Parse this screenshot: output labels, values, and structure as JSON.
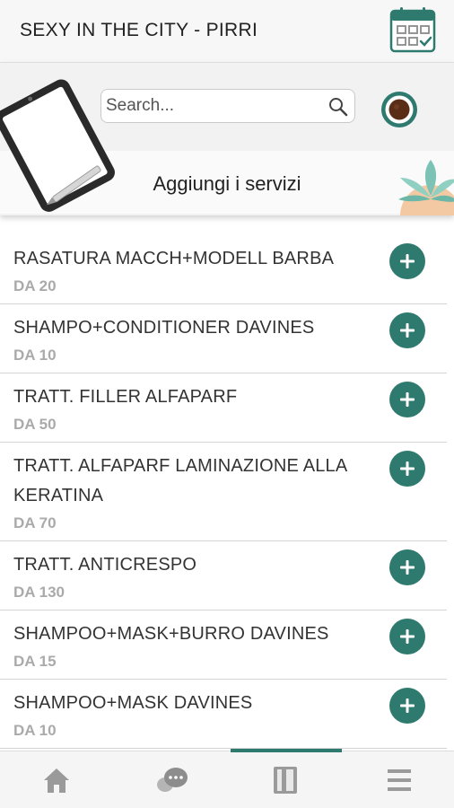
{
  "header": {
    "title": "SEXY IN THE CITY - PIRRI",
    "calendar_icon": "calendar-check-icon"
  },
  "banner": {
    "search_placeholder": "Search...",
    "search_icon": "search-icon",
    "coffee_icon": "coffee-cup-icon",
    "title": "Aggiungi i servizi"
  },
  "services": [
    {
      "name": "RASATURA MACCH+MODELL BARBA",
      "price": "DA 20"
    },
    {
      "name": "SHAMPO+CONDITIONER DAVINES",
      "price": "DA 10"
    },
    {
      "name": "TRATT. FILLER ALFAPARF",
      "price": "DA 50"
    },
    {
      "name": "TRATT. ALFAPARF LAMINAZIONE ALLA KERATINA",
      "price": "DA 70"
    },
    {
      "name": "TRATT. ANTICRESPO",
      "price": "DA 130"
    },
    {
      "name": "SHAMPOO+MASK+BURRO DAVINES",
      "price": "DA 15"
    },
    {
      "name": "SHAMPOO+MASK DAVINES",
      "price": "DA 10"
    }
  ],
  "bottom_nav": [
    {
      "icon": "home-icon"
    },
    {
      "icon": "chat-icon"
    },
    {
      "icon": "notebook-icon",
      "active": true
    },
    {
      "icon": "menu-icon"
    }
  ],
  "colors": {
    "accent": "#2f7a6e",
    "price_text": "#aaaaaa",
    "icon_gray": "#9a9a9a"
  }
}
